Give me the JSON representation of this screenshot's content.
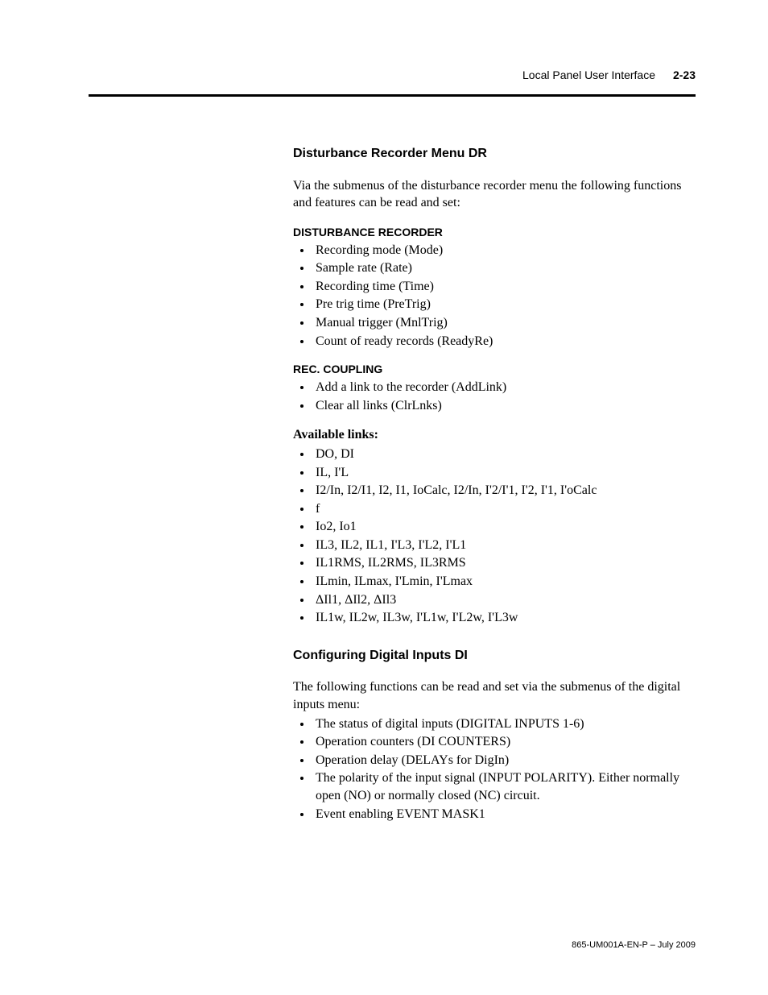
{
  "header": {
    "title": "Local Panel User Interface",
    "page": "2-23"
  },
  "section1": {
    "title": "Disturbance Recorder Menu DR",
    "intro": "Via the submenus of the disturbance recorder menu the following functions and features can be read and set:",
    "sub1_title": "DISTURBANCE RECORDER",
    "sub1_items": [
      "Recording mode (Mode)",
      "Sample rate (Rate)",
      "Recording time (Time)",
      "Pre trig time (PreTrig)",
      "Manual trigger (MnlTrig)",
      "Count of ready records (ReadyRe)"
    ],
    "sub2_title": "REC. COUPLING",
    "sub2_items": [
      "Add a link to the recorder (AddLink)",
      "Clear all links (ClrLnks)"
    ],
    "links_title": "Available links:",
    "links_items": [
      "DO, DI",
      "IL, I'L",
      "I2/In, I2/I1, I2, I1, IoCalc, I2/In, I'2/I'1, I'2, I'1, I'oCalc",
      "f",
      "Io2, Io1",
      "IL3, IL2, IL1, I'L3, I'L2, I'L1",
      "IL1RMS, IL2RMS, IL3RMS",
      "ILmin, ILmax, I'Lmin, I'Lmax",
      "ΔIl1, ΔIl2, ΔIl3",
      "IL1w, IL2w, IL3w, I'L1w, I'L2w, I'L3w"
    ]
  },
  "section2": {
    "title": "Configuring Digital Inputs DI",
    "intro": "The following functions can be read and set via the submenus of the digital inputs menu:",
    "items": [
      "The status of digital inputs (DIGITAL INPUTS 1-6)",
      "Operation counters (DI COUNTERS)",
      "Operation delay (DELAYs for DigIn)",
      "The polarity of the input signal (INPUT POLARITY). Either normally open (NO) or normally closed (NC) circuit.",
      "Event enabling EVENT MASK1"
    ]
  },
  "footer": "865-UM001A-EN-P – July 2009"
}
